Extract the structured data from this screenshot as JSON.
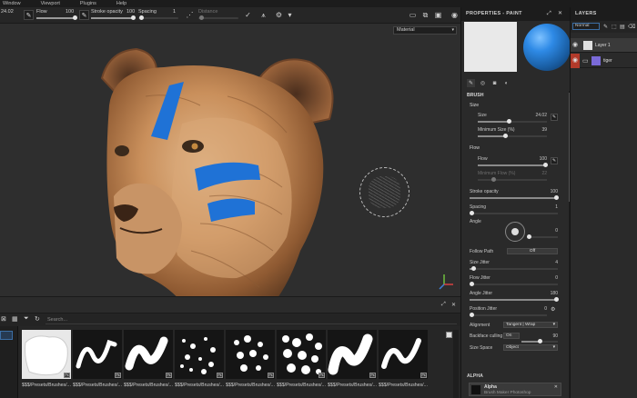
{
  "menu": [
    "Window",
    "Viewport",
    "Plugins",
    "Help"
  ],
  "toolbar": {
    "size_value": "24.02",
    "flow_label": "Flow",
    "flow_value": "100",
    "stroke_opacity_label": "Stroke opacity",
    "stroke_opacity_value": "100",
    "spacing_label": "Spacing",
    "spacing_value": "1",
    "distance_label": "Distance"
  },
  "viewport": {
    "channel_dropdown": "Material"
  },
  "shelf": {
    "search_placeholder": "Search...",
    "items": [
      {
        "label": "$$$/Presets/Brushes/..."
      },
      {
        "label": "$$$/Presets/Brushes/..."
      },
      {
        "label": "$$$/Presets/Brushes/..."
      },
      {
        "label": "$$$/Presets/Brushes/..."
      },
      {
        "label": "$$$/Presets/Brushes/..."
      },
      {
        "label": "$$$/Presets/Brushes/..."
      },
      {
        "label": "$$$/Presets/Brushes/..."
      },
      {
        "label": "$$$/Presets/Brushes/..."
      }
    ]
  },
  "properties": {
    "title": "PROPERTIES - PAINT",
    "brush_header": "BRUSH",
    "size_header": "Size",
    "size_label": "Size",
    "size_value": "24.02",
    "min_size_label": "Minimum Size (%)",
    "min_size_value": "39",
    "flow_header": "Flow",
    "flow_label": "Flow",
    "flow_value": "100",
    "min_flow_label": "Minimum Flow (%)",
    "min_flow_value": "22",
    "stroke_opacity_label": "Stroke opacity",
    "stroke_opacity_value": "100",
    "spacing_label": "Spacing",
    "spacing_value": "1",
    "angle_label": "Angle",
    "angle_value": "0",
    "follow_path_label": "Follow Path",
    "follow_path_value": "Off",
    "size_jitter_label": "Size Jitter",
    "size_jitter_value": "4",
    "flow_jitter_label": "Flow Jitter",
    "flow_jitter_value": "0",
    "angle_jitter_label": "Angle Jitter",
    "angle_jitter_value": "180",
    "position_jitter_label": "Position Jitter",
    "position_jitter_value": "0",
    "alignment_label": "Alignment",
    "alignment_value": "Tangent | Wrap",
    "backface_label": "Backface culling",
    "backface_toggle": "On",
    "backface_value": "90",
    "size_space_label": "Size Space",
    "size_space_value": "Object",
    "alpha_header": "ALPHA",
    "alpha_name": "Alpha",
    "alpha_sub": "Brush Maker Photoshop"
  },
  "layers": {
    "title": "LAYERS",
    "blend_mode": "Normal",
    "items": [
      {
        "name": "Layer 1"
      },
      {
        "name": "tiger"
      }
    ]
  },
  "colors": {
    "accent_blue": "#2e8ae6",
    "paint_blue": "#1f72d6",
    "layer_red": "#b23a2a"
  }
}
